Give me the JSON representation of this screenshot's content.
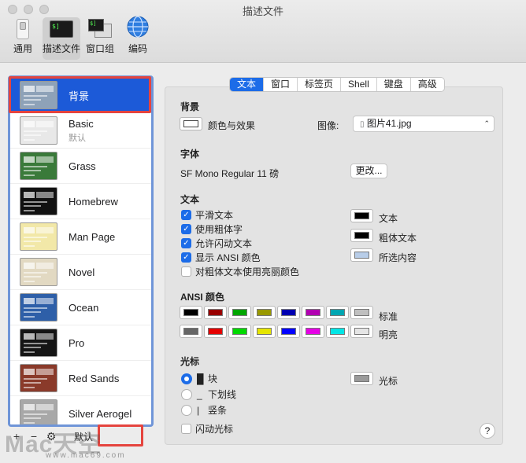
{
  "window": {
    "title": "描述文件"
  },
  "toolbar": {
    "items": [
      {
        "label": "通用",
        "icon": "switch-icon"
      },
      {
        "label": "描述文件",
        "icon": "terminal-profile-icon"
      },
      {
        "label": "窗口组",
        "icon": "window-group-icon"
      },
      {
        "label": "编码",
        "icon": "globe-icon"
      }
    ]
  },
  "sidebar": {
    "profiles": [
      {
        "name": "背景",
        "sub": "",
        "bg": "#8ea2b8",
        "selected": true
      },
      {
        "name": "Basic",
        "sub": "默认",
        "bg": "#e8e8e8"
      },
      {
        "name": "Grass",
        "sub": "",
        "bg": "#3a7a3a"
      },
      {
        "name": "Homebrew",
        "sub": "",
        "bg": "#111111"
      },
      {
        "name": "Man Page",
        "sub": "",
        "bg": "#f2e8a8"
      },
      {
        "name": "Novel",
        "sub": "",
        "bg": "#e2d9c2"
      },
      {
        "name": "Ocean",
        "sub": "",
        "bg": "#2e5fa8"
      },
      {
        "name": "Pro",
        "sub": "",
        "bg": "#151515"
      },
      {
        "name": "Red Sands",
        "sub": "",
        "bg": "#8a3a2a"
      },
      {
        "name": "Silver Aerogel",
        "sub": "",
        "bg": "#a8a8a8"
      }
    ],
    "add": "+",
    "remove": "−",
    "default_label": "默认"
  },
  "tabs": [
    "文本",
    "窗口",
    "标签页",
    "Shell",
    "键盘",
    "高级"
  ],
  "background": {
    "title": "背景",
    "color_effects": "颜色与效果",
    "image_label": "图像:",
    "image_value": "图片41.jpg"
  },
  "font": {
    "title": "字体",
    "value": "SF Mono Regular 11 磅",
    "change": "更改..."
  },
  "text": {
    "title": "文本",
    "options": [
      {
        "label": "平滑文本",
        "checked": true
      },
      {
        "label": "使用粗体字",
        "checked": true
      },
      {
        "label": "允许闪动文本",
        "checked": true
      },
      {
        "label": "显示 ANSI 颜色",
        "checked": true
      },
      {
        "label": "对粗体文本使用亮丽颜色",
        "checked": false
      }
    ],
    "swatches": [
      {
        "label": "文本",
        "color": "#000000"
      },
      {
        "label": "粗体文本",
        "color": "#000000"
      },
      {
        "label": "所选内容",
        "color": "#b8cde8"
      }
    ]
  },
  "ansi": {
    "title": "ANSI 颜色",
    "standard_label": "标准",
    "bright_label": "明亮",
    "standard": [
      "#000000",
      "#990000",
      "#00a600",
      "#999900",
      "#0000b2",
      "#b200b2",
      "#00a6b2",
      "#bfbfbf"
    ],
    "bright": [
      "#666666",
      "#e50000",
      "#00d900",
      "#e5e500",
      "#0000ff",
      "#e500e5",
      "#00e5e5",
      "#e5e5e5"
    ]
  },
  "cursor": {
    "title": "光标",
    "options": [
      {
        "label": "块",
        "glyph": "█",
        "selected": true
      },
      {
        "label": "下划线",
        "glyph": "_",
        "selected": false
      },
      {
        "label": "竖条",
        "glyph": "|",
        "selected": false
      }
    ],
    "blink": "闪动光标",
    "color_label": "光标",
    "color": "#9a9a9a"
  },
  "help": "?",
  "watermark": {
    "text": "Mac天空",
    "url": "www.mac69.com"
  }
}
